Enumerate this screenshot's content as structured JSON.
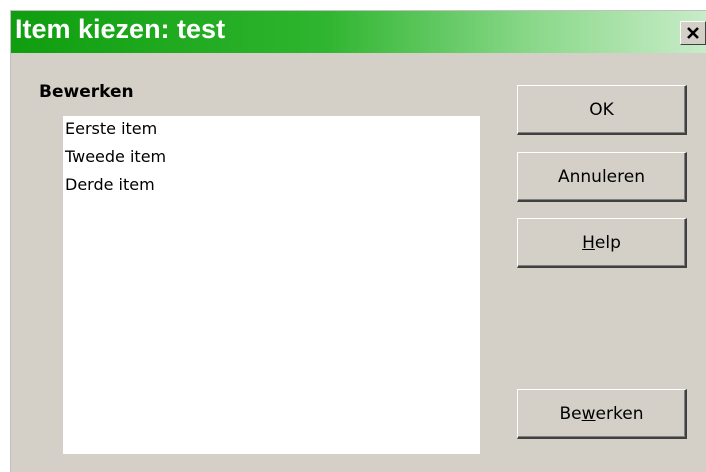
{
  "dialog": {
    "title": "Item kiezen: test",
    "close_label": "×"
  },
  "group": {
    "label": "Bewerken"
  },
  "list": {
    "items": [
      "Eerste item",
      "Tweede item",
      "Derde item"
    ]
  },
  "buttons": {
    "ok_label": "OK",
    "cancel_label": "Annuleren",
    "help_mnemonic": "H",
    "help_rest": "elp",
    "edit_before": "Be",
    "edit_mnemonic": "w",
    "edit_after": "erken"
  },
  "colors": {
    "title_gradient_start": "#0f9e0f",
    "title_gradient_end": "#c8ecc8",
    "dialog_background": "#d4d0c8"
  }
}
